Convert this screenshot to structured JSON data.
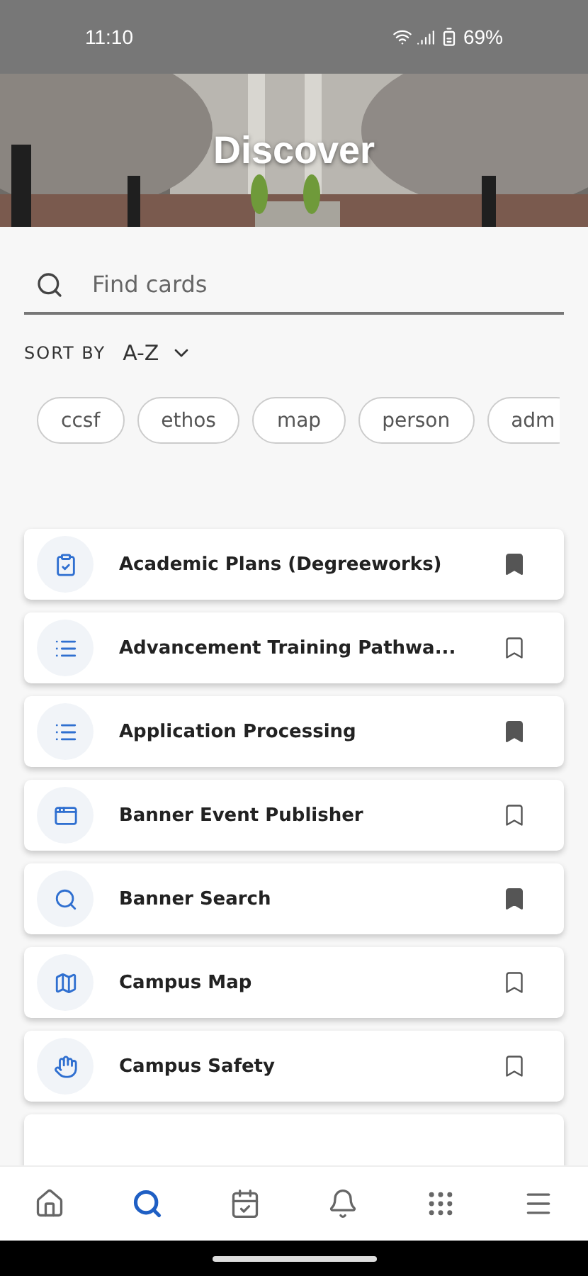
{
  "status_bar": {
    "time": "11:10",
    "battery": "69%"
  },
  "header": {
    "title": "Discover"
  },
  "search": {
    "placeholder": "Find cards"
  },
  "sort": {
    "label": "SORT BY",
    "value": "A-Z"
  },
  "chips": [
    {
      "label": "ccsf"
    },
    {
      "label": "ethos"
    },
    {
      "label": "map"
    },
    {
      "label": "person"
    },
    {
      "label": "adm"
    }
  ],
  "cards": [
    {
      "title": "Academic Plans (Degreeworks)",
      "kind": "clipboard",
      "bookmarked": true
    },
    {
      "title": "Advancement Training Pathwa...",
      "kind": "list",
      "bookmarked": false
    },
    {
      "title": "Application Processing",
      "kind": "list",
      "bookmarked": true
    },
    {
      "title": "Banner Event Publisher",
      "kind": "window",
      "bookmarked": false
    },
    {
      "title": "Banner Search",
      "kind": "search",
      "bookmarked": true
    },
    {
      "title": "Campus Map",
      "kind": "map",
      "bookmarked": false
    },
    {
      "title": "Campus Safety",
      "kind": "safety",
      "bookmarked": false
    }
  ],
  "nav": [
    {
      "kind": "home",
      "selected": false
    },
    {
      "kind": "search",
      "selected": true
    },
    {
      "kind": "calendar",
      "selected": false
    },
    {
      "kind": "bell",
      "selected": false
    },
    {
      "kind": "grid",
      "selected": false
    },
    {
      "kind": "menu",
      "selected": false
    }
  ]
}
